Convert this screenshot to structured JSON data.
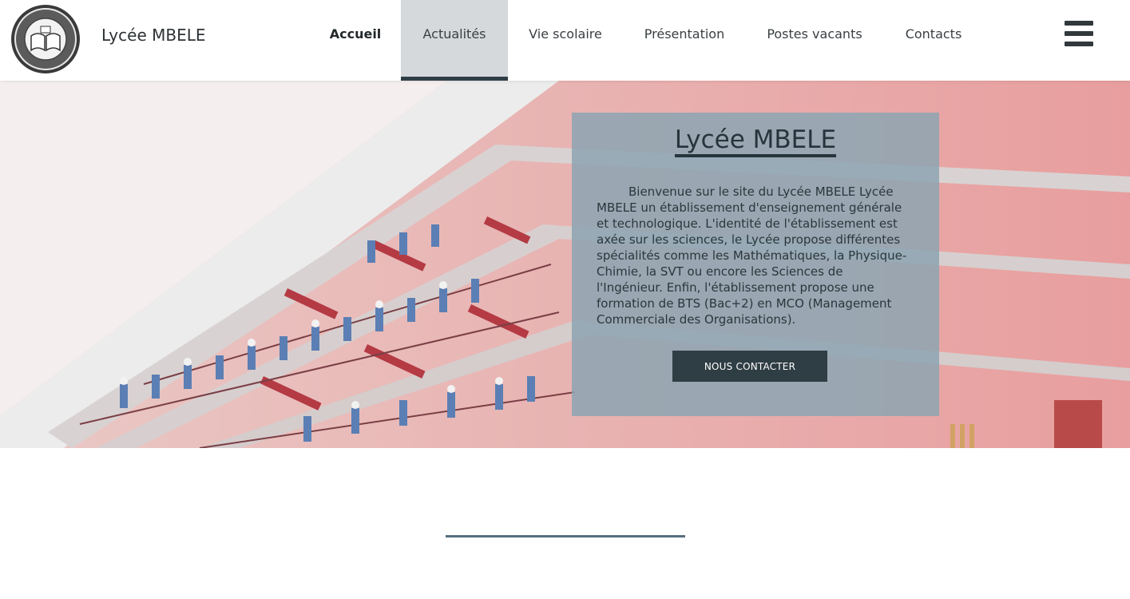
{
  "site": {
    "name": "Lycée MBELE",
    "logo_icon": "school-crest-icon"
  },
  "nav": {
    "items": [
      {
        "label": "Accueil"
      },
      {
        "label": "Actualités"
      },
      {
        "label": "Vie scolaire"
      },
      {
        "label": "Présentation"
      },
      {
        "label": "Postes vacants"
      },
      {
        "label": "Contacts"
      }
    ],
    "menu_icon": "hamburger-menu-icon"
  },
  "hero": {
    "title": "Lycée MBELE",
    "text": "Bienvenue sur le site du Lycée MBELE Lycée MBELE un établissement d'enseignement générale et technologique. L'identité de l'établissement est axée sur les sciences, le Lycée propose différentes spécialités comme les Mathématiques, la Physique-Chimie, la SVT ou encore les Sciences de l'Ingénieur. Enfin, l'établissement propose une formation de BTS (Bac+2) en MCO (Management Commerciale des Organisations).",
    "button_label": "NOUS CONTACTER"
  },
  "colors": {
    "accent": "#2f3d44",
    "active_tab_bg": "#d5d9dc",
    "card_bg": "#8ea5b2",
    "divider": "#566f7d"
  }
}
